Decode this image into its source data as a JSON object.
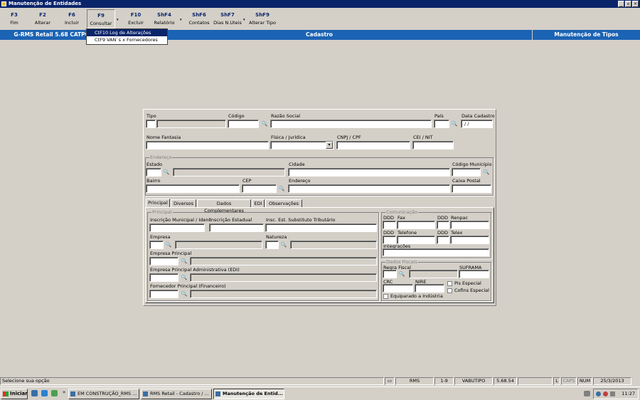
{
  "window": {
    "title": "Manutenção de Entidades"
  },
  "toolbar": {
    "buttons": [
      {
        "key": "F3",
        "label": "Fim"
      },
      {
        "key": "F2",
        "label": "Alterar"
      },
      {
        "key": "F6",
        "label": "Incluir"
      },
      {
        "key": "F9",
        "label": "Consultar"
      },
      {
        "key": "F10",
        "label": "Excluir"
      },
      {
        "key": "ShF4",
        "label": "Relatório"
      },
      {
        "key": "ShF6",
        "label": "Contatos"
      },
      {
        "key": "ShF7",
        "label": "Dias N.Uteis"
      },
      {
        "key": "ShF9",
        "label": "Alterar Tipo"
      }
    ]
  },
  "dropdown_menu": {
    "items": [
      "CtF10 Log de Alterações",
      "CtF9  VAN`s x Fornecedores"
    ]
  },
  "header": {
    "app": "G-RMS Retail 5.68 CATPC I",
    "center": "Cadastro",
    "right": "Manutenção de Tipos"
  },
  "form": {
    "tipo": "Tipo",
    "codigo": "Código",
    "razao_social": "Razão Social",
    "pais": "País",
    "data_cadastro": "Data Cadastro",
    "data_cadastro_value": " / /",
    "nome_fantasia": "Nome Fantasia",
    "fisica_juridica": "Física / Jurídica",
    "cnpj_cpf": "CNPJ / CPF",
    "cei_nit": "CEI / NIT",
    "endereco_group": "Endereço",
    "estado": "Estado",
    "cidade": "Cidade",
    "codigo_municipio": "Código Município",
    "bairro": "Bairro",
    "cep": "CEP",
    "endereco": "Endereço",
    "caixa_postal": "Caixa Postal"
  },
  "tabs": [
    "Principal",
    "Diversos",
    "Dados Complementares",
    "EDI",
    "Observações"
  ],
  "principal": {
    "group": "Principal",
    "inscricao_municipal": "Inscrição Municipal / Ident",
    "inscricao_estadual": "Inscrição Estadual",
    "insc_est_substituto": "Insc. Est. Substituto Tributário",
    "empresa": "Empresa",
    "natureza": "Natureza",
    "empresa_principal": "Empresa Principal",
    "empresa_principal_adm": "Empresa Principal Administrativa (EDI)",
    "fornecedor_principal": "Fornecedor Principal (Financeiro)"
  },
  "comunicacao": {
    "group": "Comunicação",
    "ddd": "DDD",
    "fax": "Fax",
    "renpac": "Renpac",
    "telefone": "Telefone",
    "telex": "Telex",
    "integracoes": "Integrações"
  },
  "dados_fiscais": {
    "group": "Dados Fiscais",
    "regra_fiscal": "Regra Fiscal",
    "suframa": "SUFRAMA",
    "crc": "CRC",
    "nire": "NIRE",
    "pis_especial": "Pis Especial",
    "cofins_especial": "Cofins Especial",
    "equiparado": "Equiparado a Indústria"
  },
  "statusbar": {
    "message": "Selecione sua opção",
    "cells": [
      "RMS",
      "1-9",
      "VABUTIPO",
      "5.68.54",
      "L",
      "CAPS",
      "NUM",
      "25/3/2013"
    ]
  },
  "taskbar": {
    "start": "Iniciar",
    "tasks": [
      "EM CONSTRUÇÃO_RMS ...",
      "RMS Retail - Cadastro / ...",
      "Manutenção de Entid..."
    ],
    "clock": "11:27"
  }
}
